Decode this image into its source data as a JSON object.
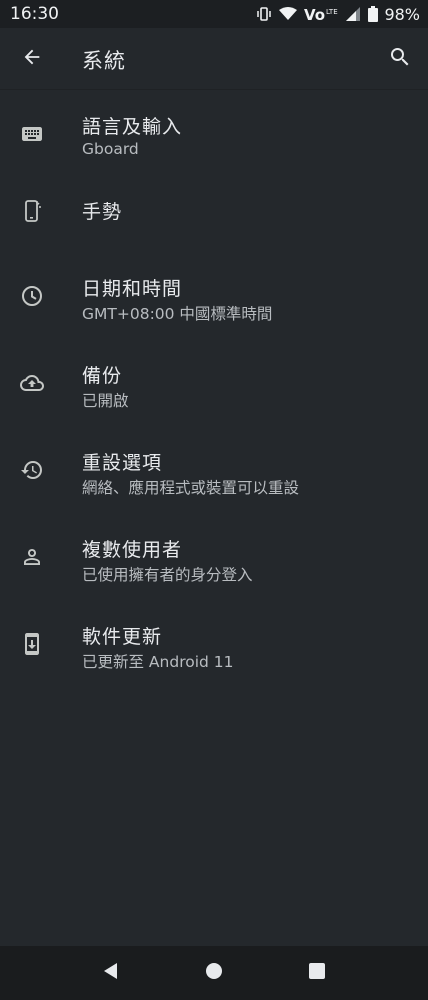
{
  "status_bar": {
    "time": "16:30",
    "battery_percent": "98%",
    "icons": [
      "vibrate-icon",
      "wifi-icon",
      "volte-icon",
      "signal-icon",
      "battery-icon"
    ]
  },
  "app_bar": {
    "title": "系統",
    "back_icon": "arrow-back-icon",
    "search_icon": "search-icon"
  },
  "settings": {
    "items": [
      {
        "icon": "keyboard-icon",
        "title": "語言及輸入",
        "subtitle": "Gboard"
      },
      {
        "icon": "gesture-icon",
        "title": "手勢",
        "subtitle": ""
      },
      {
        "icon": "clock-icon",
        "title": "日期和時間",
        "subtitle": "GMT+08:00 中國標準時間"
      },
      {
        "icon": "cloud-upload-icon",
        "title": "備份",
        "subtitle": "已開啟"
      },
      {
        "icon": "history-icon",
        "title": "重設選項",
        "subtitle": "網絡、應用程式或裝置可以重設"
      },
      {
        "icon": "person-icon",
        "title": "複數使用者",
        "subtitle": "已使用擁有者的身分登入"
      },
      {
        "icon": "system-update-icon",
        "title": "軟件更新",
        "subtitle": "已更新至 Android 11"
      }
    ]
  },
  "nav_bar": {
    "buttons": [
      "back-triangle-icon",
      "home-circle-icon",
      "recents-square-icon"
    ]
  }
}
